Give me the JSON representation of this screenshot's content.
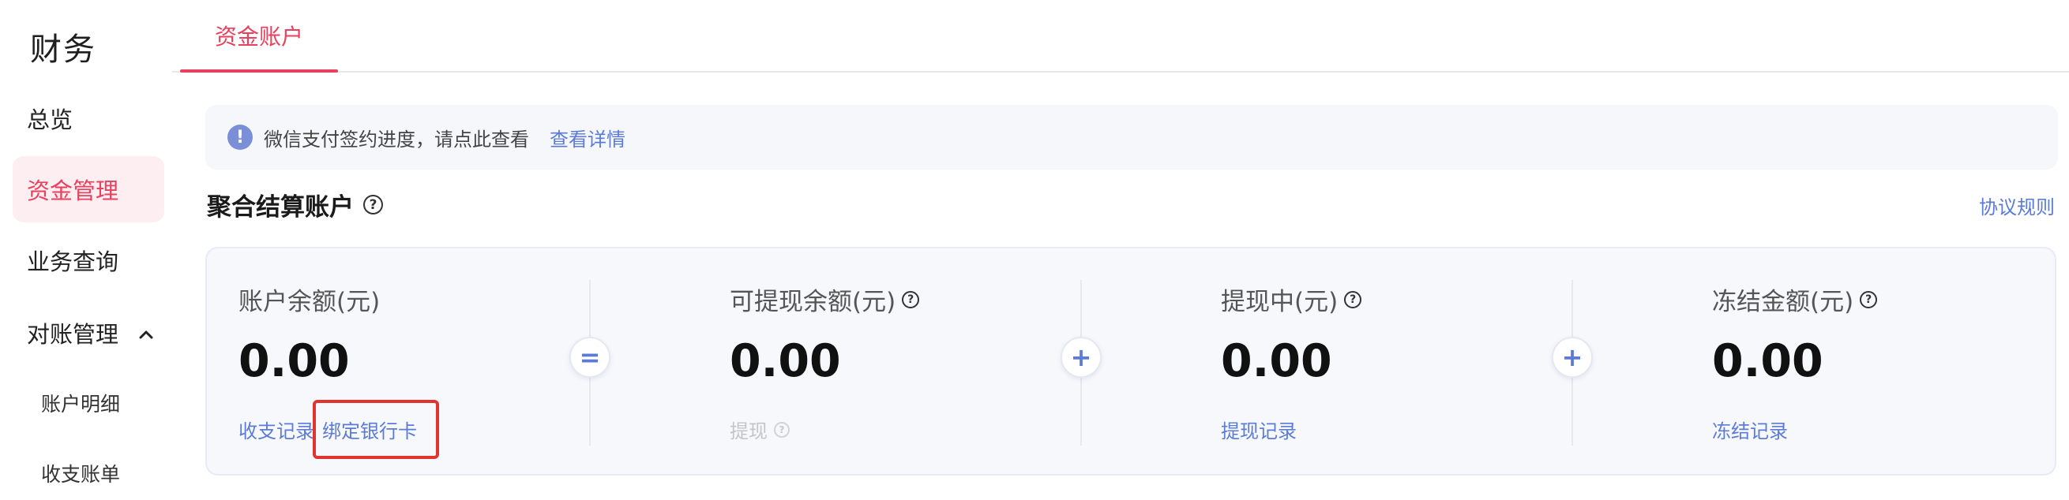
{
  "sidebar": {
    "title": "财务",
    "items": [
      {
        "label": "总览"
      },
      {
        "label": "资金管理"
      },
      {
        "label": "业务查询"
      },
      {
        "label": "对账管理"
      }
    ],
    "sub_items": [
      {
        "label": "账户明细"
      },
      {
        "label": "收支账单"
      }
    ]
  },
  "tabs": [
    {
      "label": "资金账户"
    }
  ],
  "notice": {
    "text": "微信支付签约进度，请点此查看",
    "link": "查看详情"
  },
  "section": {
    "title": "聚合结算账户",
    "rules_link": "协议规则"
  },
  "columns": [
    {
      "label": "账户余额(元)",
      "amount": "0.00",
      "links": [
        "收支记录",
        "绑定银行卡"
      ]
    },
    {
      "label": "可提现余额(元)",
      "amount": "0.00",
      "links": [
        "提现"
      ]
    },
    {
      "label": "提现中(元)",
      "amount": "0.00",
      "links": [
        "提现记录"
      ]
    },
    {
      "label": "冻结金额(元)",
      "amount": "0.00",
      "links": [
        "冻结记录"
      ]
    }
  ],
  "operators": [
    "=",
    "+",
    "+"
  ],
  "colors": {
    "accent": "#e8405d",
    "link": "#5b7bd6",
    "highlight_box": "#e0352f"
  }
}
